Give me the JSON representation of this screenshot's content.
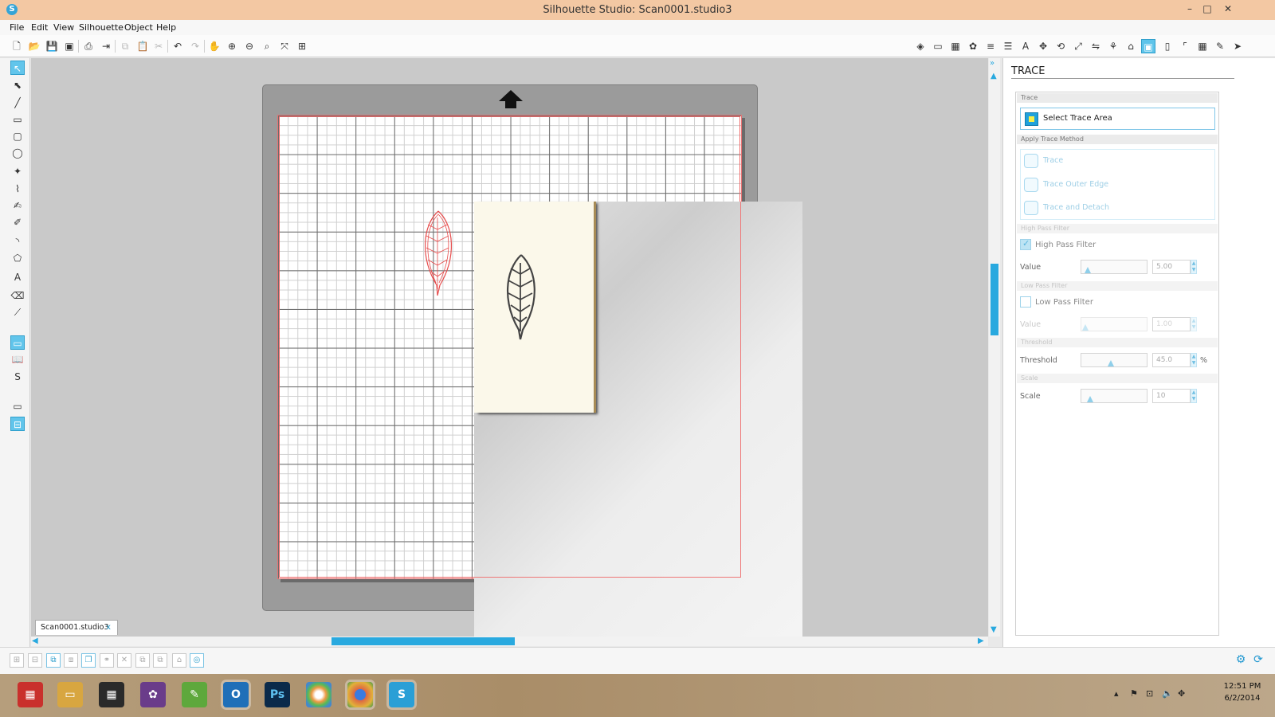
{
  "window": {
    "title": "Silhouette Studio: Scan0001.studio3",
    "minimize": "–",
    "maximize": "□",
    "close": "✕"
  },
  "menu": [
    "File",
    "Edit",
    "View",
    "Silhouette",
    "Object",
    "Help"
  ],
  "document_tab": {
    "label": "Scan0001.studio3",
    "close": "x"
  },
  "trace_panel": {
    "title": "TRACE",
    "trace_section": "Trace",
    "select_trace_area": "Select Trace Area",
    "apply_method_section": "Apply Trace Method",
    "methods": [
      "Trace",
      "Trace Outer Edge",
      "Trace and Detach"
    ],
    "high_pass_section": "High Pass Filter",
    "high_pass": {
      "label": "High Pass Filter",
      "checked": true,
      "value_label": "Value",
      "value": "5.00",
      "level": 0.05
    },
    "low_pass_section": "Low Pass Filter",
    "low_pass": {
      "label": "Low Pass Filter",
      "checked": false,
      "value_label": "Value",
      "value": "1.00",
      "level": 0.02
    },
    "threshold_section": "Threshold",
    "threshold": {
      "label": "Threshold",
      "value": "45.0",
      "unit": "%",
      "level": 0.45
    },
    "scale_section": "Scale",
    "scale": {
      "label": "Scale",
      "value": "10",
      "level": 0.1
    }
  },
  "taskbar": {
    "apps": [
      "start",
      "file-explorer",
      "calculator",
      "photos",
      "evernote",
      "outlook",
      "photoshop",
      "picasa",
      "chrome",
      "silhouette-studio"
    ],
    "ps_label": "Ps",
    "outlook_label": "O",
    "silhouette_label": "S",
    "time": "12:51 PM",
    "date": "6/2/2014"
  },
  "colors": {
    "accent": "#29a9df",
    "titlebar": "#f3c8a3",
    "cut_line": "#e66666",
    "trace_red": "#e74c4c"
  }
}
